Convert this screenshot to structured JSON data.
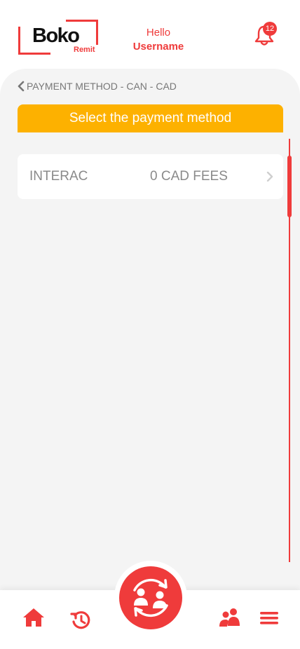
{
  "header": {
    "logo_text": "Boko",
    "logo_sub": "Remit",
    "greeting": "Hello",
    "username": "Username",
    "notification_count": "12"
  },
  "page": {
    "back_label": "PAYMENT METHOD - CAN - CAD",
    "banner": "Select the payment method"
  },
  "methods": [
    {
      "name": "INTERAC",
      "fees": "0 CAD FEES"
    }
  ],
  "nav": {
    "items": [
      "home-icon",
      "history-icon",
      "transfer-icon",
      "contacts-icon",
      "menu-icon"
    ]
  },
  "colors": {
    "brand_red": "#ef3b3b",
    "banner_orange": "#fdb100",
    "panel_bg": "#f4f4f4",
    "muted_text": "#8a8a8a"
  }
}
